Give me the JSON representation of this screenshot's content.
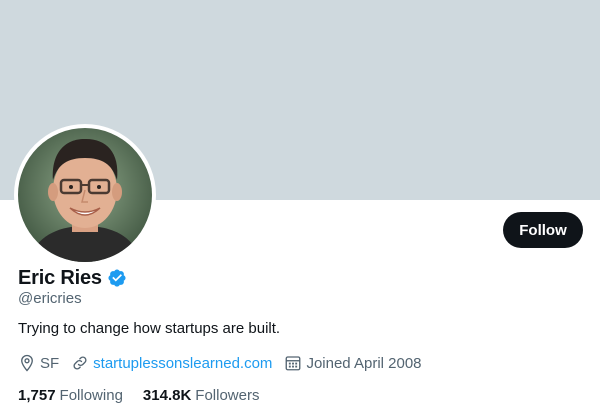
{
  "profile": {
    "display_name": "Eric Ries",
    "handle": "@ericries",
    "bio": "Trying to change how startups are built.",
    "follow_label": "Follow"
  },
  "meta": {
    "location": "SF",
    "website": "startuplessonslearned.com",
    "joined": "Joined April 2008"
  },
  "stats": {
    "following_count": "1,757",
    "following_label": "Following",
    "followers_count": "314.8K",
    "followers_label": "Followers"
  },
  "colors": {
    "banner": "#cfd9de",
    "accent": "#1d9bf0",
    "text_primary": "#0f1419",
    "text_secondary": "#536471",
    "button_bg": "#0f1419"
  },
  "icons": {
    "verified": "verified-badge-icon",
    "location": "location-pin-icon",
    "link": "link-icon",
    "calendar": "calendar-icon"
  }
}
